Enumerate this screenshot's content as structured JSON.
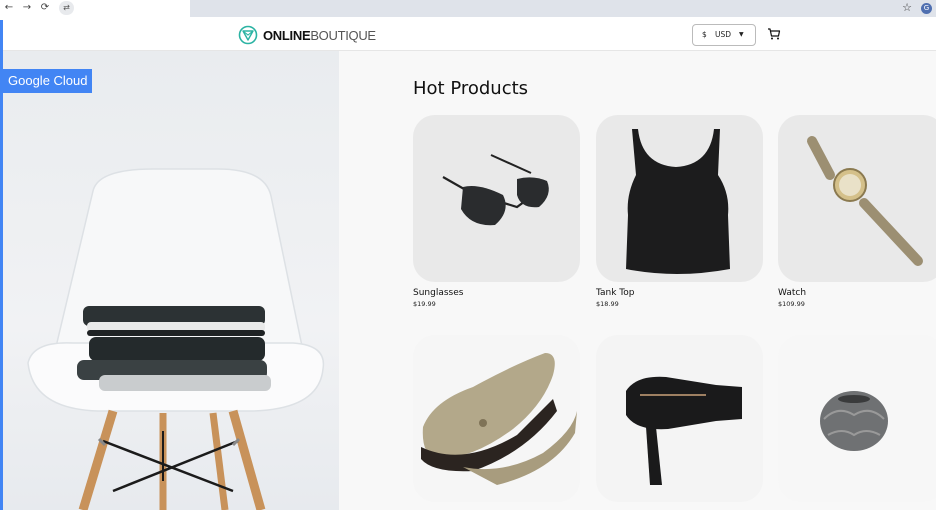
{
  "browser": {
    "back_icon": "←",
    "forward_icon": "→",
    "reload_icon": "⟳",
    "site_info_icon": "⇄",
    "bookmark_icon": "☆",
    "extension_letter": "G"
  },
  "brand": {
    "bold": "ONLINE",
    "light": "BOUTIQUE",
    "accent_color": "#2bb3a3"
  },
  "currency": {
    "symbol": "$",
    "code": "USD",
    "caret": "▼"
  },
  "badge": {
    "label": "Google Cloud",
    "color": "#4285f4"
  },
  "products": {
    "heading": "Hot Products",
    "items": [
      {
        "name": "Sunglasses",
        "price": "$19.99",
        "icon": "sunglasses"
      },
      {
        "name": "Tank Top",
        "price": "$18.99",
        "icon": "tank-top"
      },
      {
        "name": "Watch",
        "price": "$109.99",
        "icon": "watch"
      },
      {
        "name": "",
        "price": "",
        "icon": "loafers"
      },
      {
        "name": "",
        "price": "",
        "icon": "hair-dryer"
      },
      {
        "name": "",
        "price": "",
        "icon": "candle-holder"
      }
    ]
  }
}
